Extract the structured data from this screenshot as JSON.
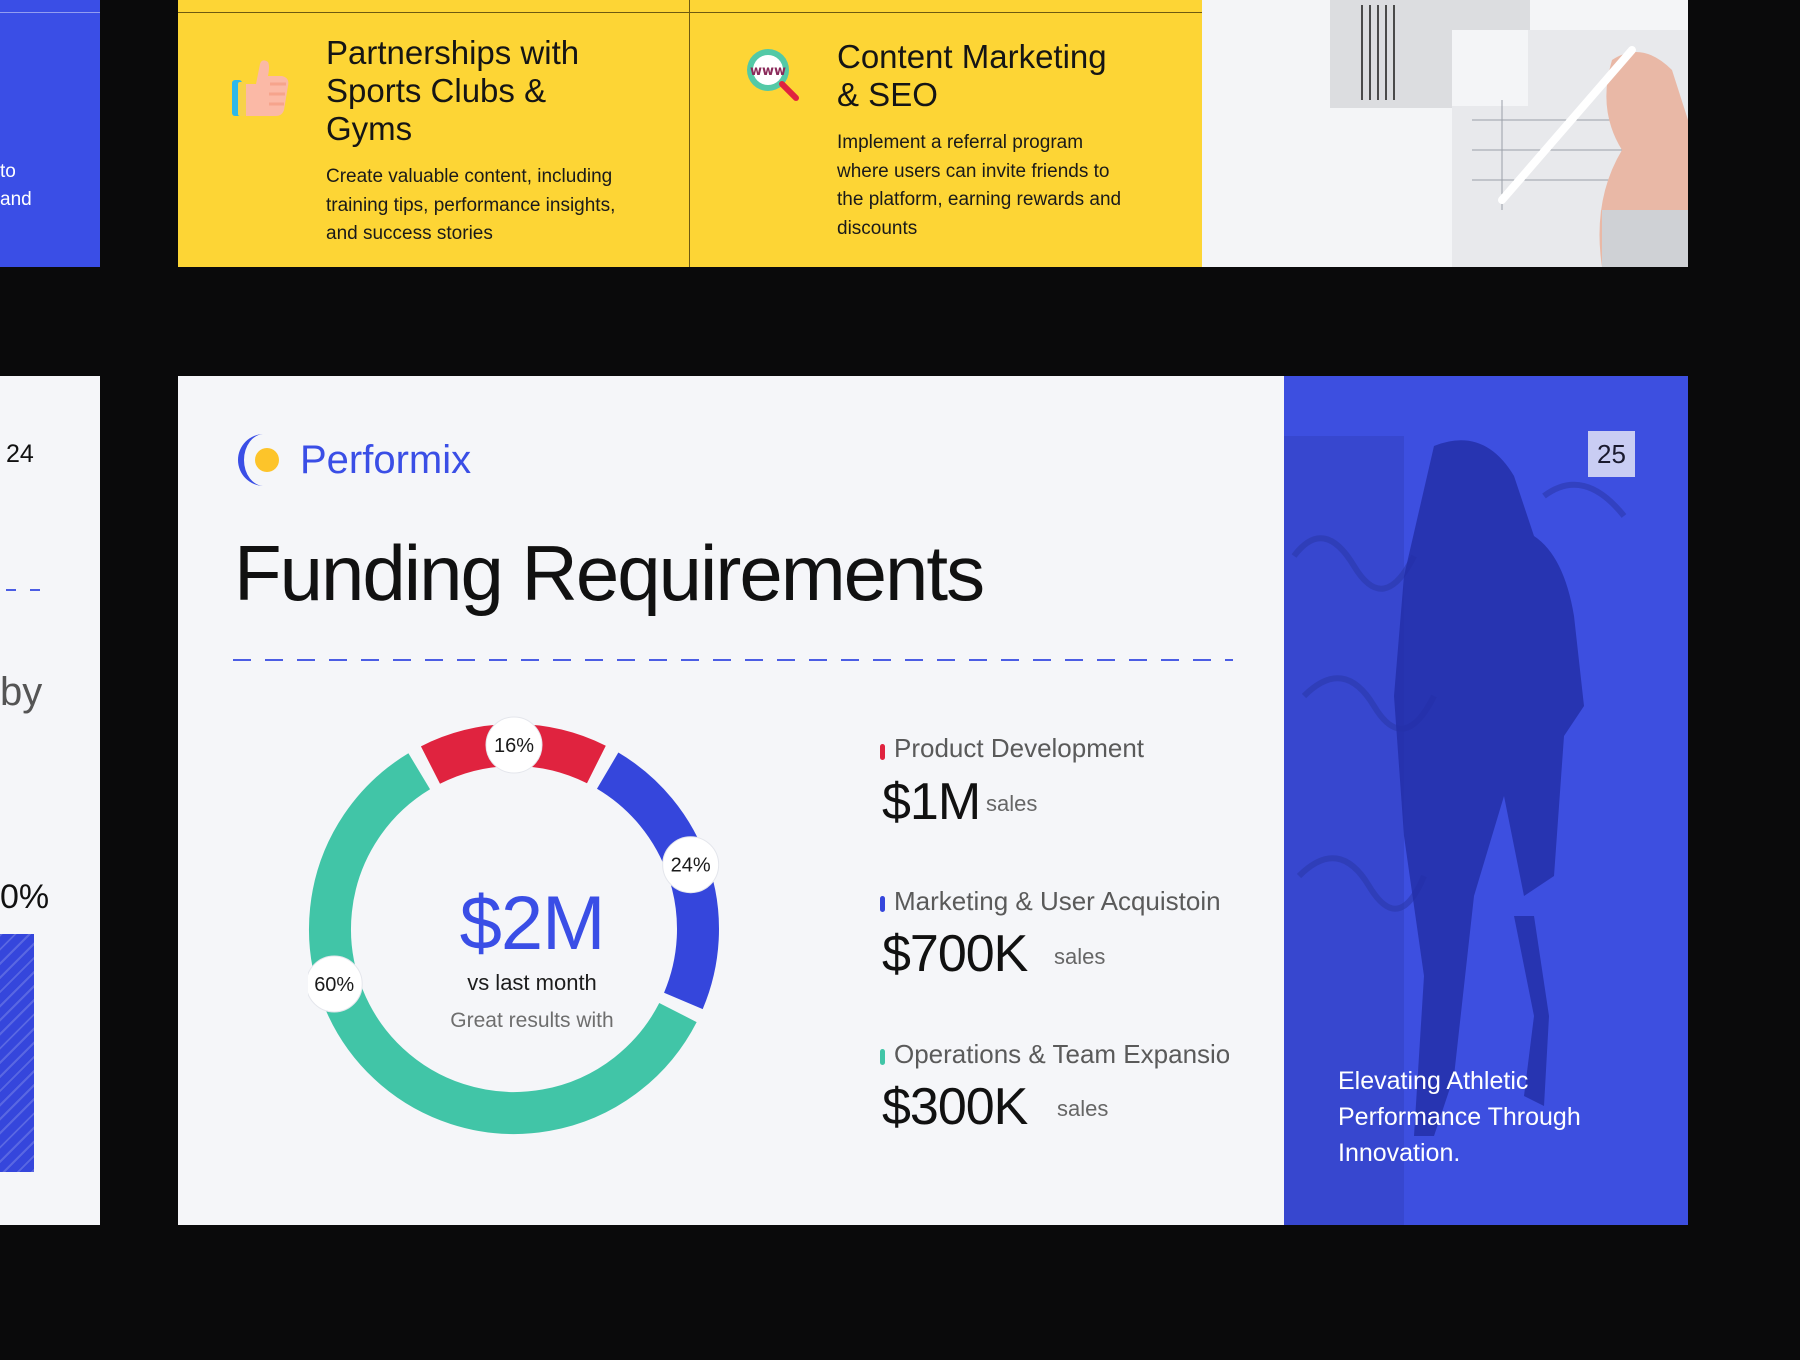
{
  "top_left_card": {
    "text_line1": "to",
    "text_line2": "and"
  },
  "top_cards": [
    {
      "title_lines": [
        "Partnerships with",
        "Sports Clubs &",
        "Gyms"
      ],
      "body_lines": [
        "Create valuable content, including",
        "training tips, performance insights,",
        "and success stories"
      ],
      "icon": "thumbs-up-icon"
    },
    {
      "title_lines": [
        "Content Marketing",
        "& SEO"
      ],
      "body_lines": [
        "Implement a referral program",
        "where users can invite friends to",
        "the platform, earning rewards and",
        "discounts"
      ],
      "icon": "www-search-icon"
    }
  ],
  "left_slide": {
    "page_number": "24",
    "partial_word": "by",
    "partial_percent": "0%"
  },
  "main_slide": {
    "brand": "Performix",
    "title": "Funding Requirements",
    "donut_center": {
      "value": "$2M",
      "subtitle": "vs last month",
      "note": "Great results with"
    },
    "segments": [
      {
        "label": "16%",
        "percent": 16,
        "color": "#e0233f"
      },
      {
        "label": "24%",
        "percent": 24,
        "color": "#3546dc"
      },
      {
        "label": "60%",
        "percent": 60,
        "color": "#41c5a7"
      }
    ],
    "funds": [
      {
        "label": "Product Development",
        "amount": "$1M",
        "unit": "sales",
        "color": "#e0233f"
      },
      {
        "label": "Marketing & User Acquistoin",
        "amount": "$700K",
        "unit": "sales",
        "color": "#3546dc"
      },
      {
        "label": "Operations & Team Expansion",
        "amount": "$300K",
        "unit": "sales",
        "color": "#41c5a7"
      }
    ]
  },
  "right_slide": {
    "page_number": "25",
    "caption_lines": [
      "Elevating Athletic",
      "Performance Through",
      "Innovation."
    ]
  },
  "colors": {
    "brand_blue": "#3a4ee6",
    "yellow": "#fdd535",
    "background": "#0a0a0b"
  }
}
